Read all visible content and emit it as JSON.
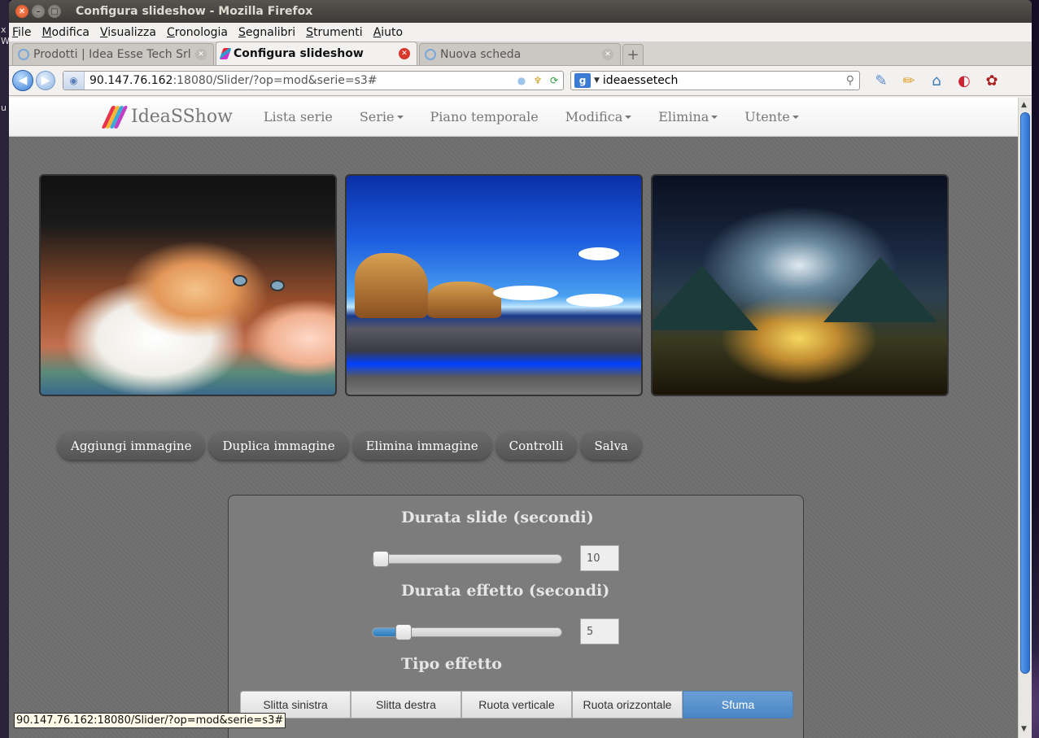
{
  "window": {
    "title": "Configura slideshow - Mozilla Firefox"
  },
  "menu": [
    "File",
    "Modifica",
    "Visualizza",
    "Cronologia",
    "Segnalibri",
    "Strumenti",
    "Aiuto"
  ],
  "tabs": [
    {
      "label": "Prodotti | Idea Esse Tech Srl"
    },
    {
      "label": "Configura slideshow"
    },
    {
      "label": "Nuova scheda"
    }
  ],
  "url": {
    "host": "90.147.76.162",
    "rest": ":18080/Slider/?op=mod&serie=s3#"
  },
  "search": {
    "value": "ideaessetech",
    "engine_icon": "g-icon"
  },
  "app": {
    "brand": "IdeaSShow",
    "nav": [
      "Lista serie",
      "Serie",
      "Piano temporale",
      "Modifica",
      "Elimina",
      "Utente"
    ],
    "logo_colors": [
      "#e8334a",
      "#f7b733",
      "#3aa9d8",
      "#c23fc4"
    ]
  },
  "gallery": [
    {
      "alt": "kitten"
    },
    {
      "alt": "beach"
    },
    {
      "alt": "mountains"
    }
  ],
  "actions": [
    "Aggiungi immagine",
    "Duplica immagine",
    "Elimina immagine",
    "Controlli",
    "Salva"
  ],
  "settings": {
    "slide_title": "Durata slide (secondi)",
    "slide_value": "10",
    "slide_fraction": 0.0,
    "effect_title": "Durata effetto (secondi)",
    "effect_value": "5",
    "effect_fraction": 0.13,
    "type_title": "Tipo effetto",
    "effects": [
      "Slitta sinistra",
      "Slitta destra",
      "Ruota verticale",
      "Ruota orizzontale",
      "Sfuma"
    ],
    "selected_effect": "Sfuma",
    "accent": "#4a86c4"
  },
  "status": "90.147.76.162:18080/Slider/?op=mod&serie=s3#"
}
